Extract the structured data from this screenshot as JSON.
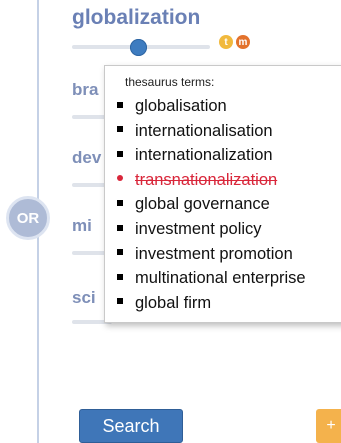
{
  "connector": {
    "label": "OR"
  },
  "term": {
    "title": "globalization",
    "buttons": {
      "t_label": "t",
      "m_label": "m"
    },
    "slider_level": 0.6
  },
  "other_terms": [
    {
      "partial": "bra"
    },
    {
      "partial": "dev"
    },
    {
      "partial": "mi"
    },
    {
      "partial": "sci"
    }
  ],
  "popup": {
    "header": "thesaurus terms:",
    "items": [
      {
        "label": "globalisation",
        "removed": false
      },
      {
        "label": "internationalisation",
        "removed": false
      },
      {
        "label": "internationalization",
        "removed": false
      },
      {
        "label": "transnationalization",
        "removed": true
      },
      {
        "label": "global governance",
        "removed": false
      },
      {
        "label": "investment policy",
        "removed": false
      },
      {
        "label": "investment promotion",
        "removed": false
      },
      {
        "label": "multinational enterprise",
        "removed": false
      },
      {
        "label": "global firm",
        "removed": false
      }
    ]
  },
  "actions": {
    "search_label": "Search",
    "add_label": "+"
  },
  "colors": {
    "accent": "#3f76b8",
    "removed": "#d9263a",
    "plus": "#f4b24c"
  }
}
